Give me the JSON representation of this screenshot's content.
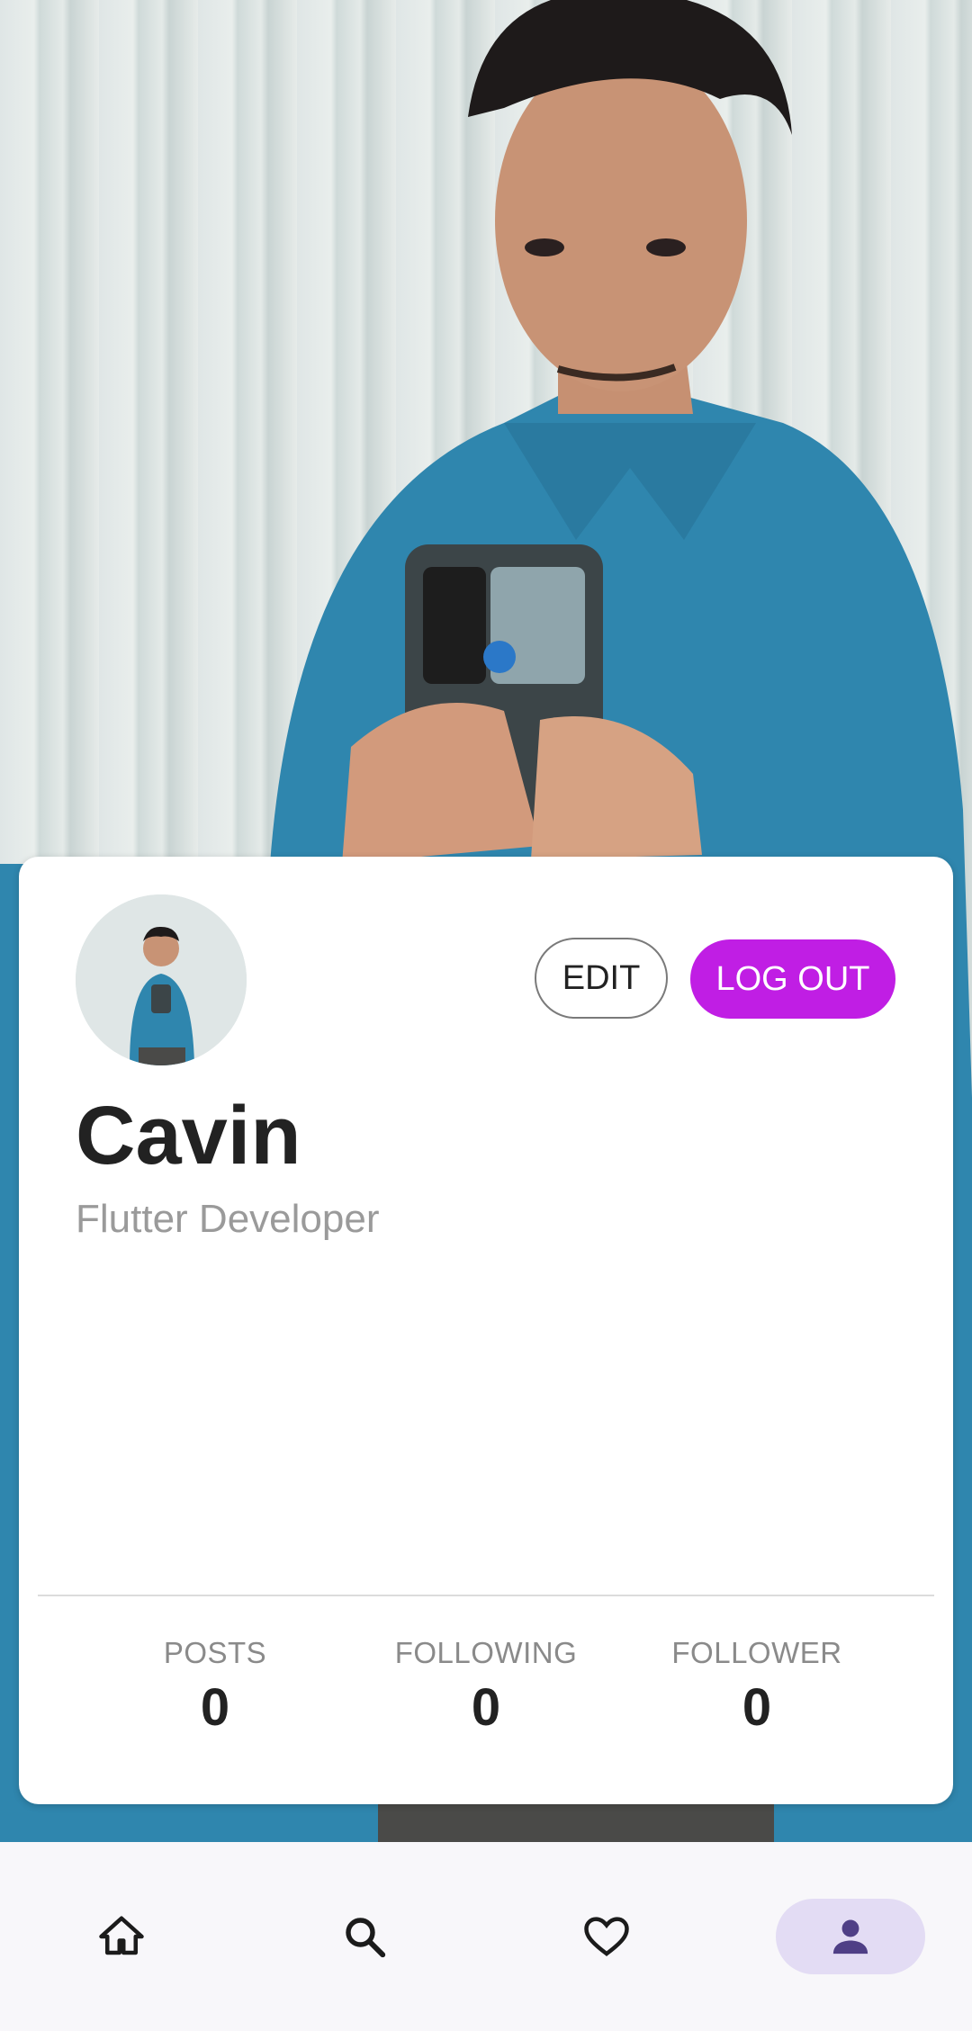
{
  "profile": {
    "name": "Cavin",
    "role": "Flutter Developer",
    "edit_label": "EDIT",
    "logout_label": "LOG OUT"
  },
  "stats": [
    {
      "label": "POSTS",
      "value": "0"
    },
    {
      "label": "FOLLOWING",
      "value": "0"
    },
    {
      "label": "FOLLOWER",
      "value": "0"
    }
  ],
  "bottom_nav": {
    "items": [
      {
        "icon": "home-icon",
        "active": false
      },
      {
        "icon": "search-icon",
        "active": false
      },
      {
        "icon": "heart-icon",
        "active": false
      },
      {
        "icon": "person-icon",
        "active": true
      }
    ]
  },
  "colors": {
    "accent": "#c01ee4",
    "nav_active_bg": "#e3dcf4",
    "nav_active_icon": "#5a4a8a"
  }
}
